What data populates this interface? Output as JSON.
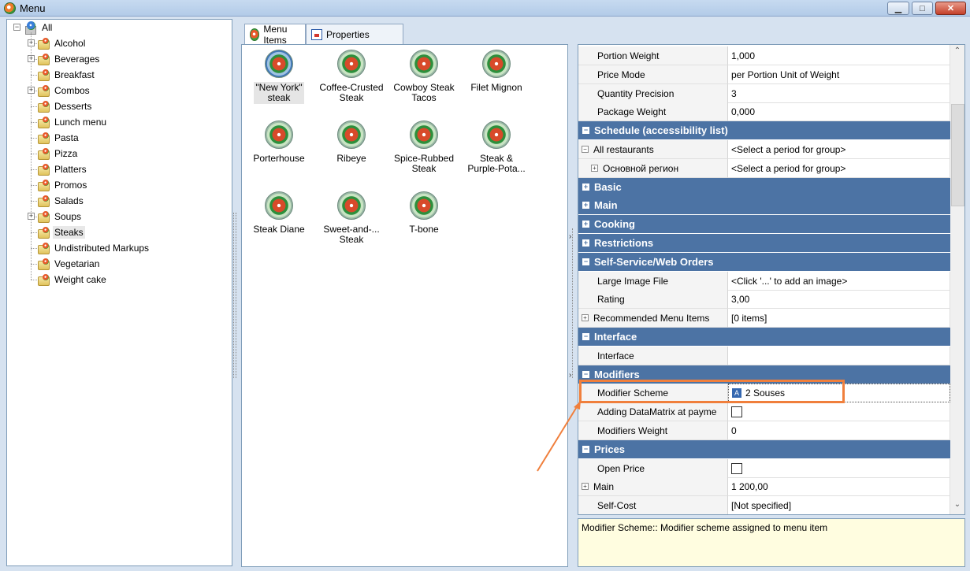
{
  "window": {
    "title": "Menu"
  },
  "tree": {
    "root": "All",
    "items": [
      {
        "label": "Alcohol",
        "expandable": true
      },
      {
        "label": "Beverages",
        "expandable": true
      },
      {
        "label": "Breakfast",
        "expandable": false
      },
      {
        "label": "Combos",
        "expandable": true
      },
      {
        "label": "Desserts",
        "expandable": false
      },
      {
        "label": "Lunch menu",
        "expandable": false
      },
      {
        "label": "Pasta",
        "expandable": false
      },
      {
        "label": "Pizza",
        "expandable": false
      },
      {
        "label": "Platters",
        "expandable": false
      },
      {
        "label": "Promos",
        "expandable": false
      },
      {
        "label": "Salads",
        "expandable": false
      },
      {
        "label": "Soups",
        "expandable": true
      },
      {
        "label": "Steaks",
        "expandable": false,
        "selected": true
      },
      {
        "label": "Undistributed Markups",
        "expandable": false
      },
      {
        "label": "Vegetarian",
        "expandable": false
      },
      {
        "label": "Weight cake",
        "expandable": false
      }
    ]
  },
  "tabs": [
    {
      "label": "Menu Items",
      "active": true
    },
    {
      "label": "Properties",
      "active": false
    }
  ],
  "menu_items": [
    {
      "line1": "\"New York\"",
      "line2": "steak",
      "selected": true
    },
    {
      "line1": "Coffee-Crusted",
      "line2": "Steak"
    },
    {
      "line1": "Cowboy Steak",
      "line2": "Tacos"
    },
    {
      "line1": "Filet Mignon",
      "line2": ""
    },
    {
      "line1": "Porterhouse",
      "line2": ""
    },
    {
      "line1": "Ribeye",
      "line2": ""
    },
    {
      "line1": "Spice-Rubbed",
      "line2": "Steak"
    },
    {
      "line1": "Steak &",
      "line2": "Purple-Pota..."
    },
    {
      "line1": "Steak Diane",
      "line2": ""
    },
    {
      "line1": "Sweet-and-...",
      "line2": "Steak"
    },
    {
      "line1": "T-bone",
      "line2": ""
    }
  ],
  "properties": {
    "rows": [
      {
        "type": "prop",
        "key": "Portion Weight",
        "value": "1,000"
      },
      {
        "type": "prop",
        "key": "Price Mode",
        "value": "per Portion Unit of Weight"
      },
      {
        "type": "prop",
        "key": "Quantity Precision",
        "value": "3"
      },
      {
        "type": "prop",
        "key": "Package Weight",
        "value": "0,000"
      },
      {
        "type": "cat",
        "key": "Schedule (accessibility list)",
        "expanded": true
      },
      {
        "type": "prop",
        "key": "All restaurants",
        "value": "<Select a period for group>",
        "pm": "minus",
        "indent": 0
      },
      {
        "type": "prop",
        "key": "Основной регион",
        "value": "<Select a period for group>",
        "pm": "plus",
        "indent": 1
      },
      {
        "type": "cat",
        "key": "Basic",
        "expanded": false
      },
      {
        "type": "cat",
        "key": "Main",
        "expanded": false
      },
      {
        "type": "cat",
        "key": "Cooking",
        "expanded": false
      },
      {
        "type": "cat",
        "key": "Restrictions",
        "expanded": false
      },
      {
        "type": "cat",
        "key": "Self-Service/Web Orders",
        "expanded": true
      },
      {
        "type": "prop",
        "key": "Large Image File",
        "value": "<Click '...' to add an image>"
      },
      {
        "type": "prop",
        "key": "Rating",
        "value": "3,00"
      },
      {
        "type": "prop",
        "key": "Recommended Menu Items",
        "value": "[0 items]",
        "pm": "plus"
      },
      {
        "type": "cat",
        "key": "Interface",
        "expanded": true
      },
      {
        "type": "prop",
        "key": "Interface",
        "value": ""
      },
      {
        "type": "cat",
        "key": "Modifiers",
        "expanded": true
      },
      {
        "type": "prop",
        "key": "Modifier Scheme",
        "value": "2 Souses",
        "badge": "A"
      },
      {
        "type": "prop",
        "key": "Adding DataMatrix at payme",
        "value": "",
        "checkbox": true
      },
      {
        "type": "prop",
        "key": "Modifiers Weight",
        "value": "0"
      },
      {
        "type": "cat",
        "key": "Prices",
        "expanded": true
      },
      {
        "type": "prop",
        "key": "Open Price",
        "value": "",
        "checkbox": true
      },
      {
        "type": "prop",
        "key": "Main",
        "value": "1 200,00",
        "pm": "plus"
      },
      {
        "type": "prop",
        "key": "Self-Cost",
        "value": "[Not specified]"
      }
    ]
  },
  "description": "Modifier Scheme:: Modifier scheme assigned to menu item",
  "colors": {
    "category_band": "#4c73a4",
    "highlight": "#f07f3c",
    "description_bg": "#fffde0"
  }
}
